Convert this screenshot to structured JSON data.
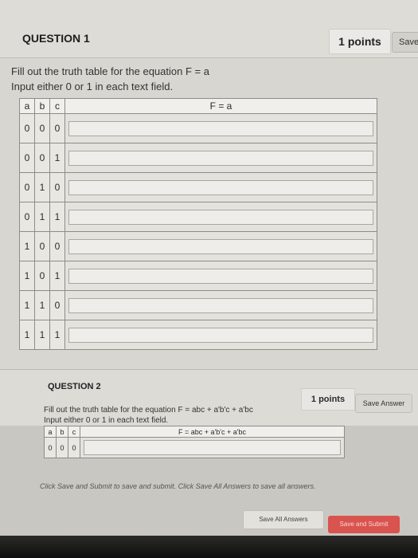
{
  "question1": {
    "title": "QUESTION 1",
    "points": "1 points",
    "save_label": "Save",
    "prompt": "Fill out the truth table for the equation F = a",
    "instructions": "Input either 0 or 1 in each text field.",
    "table": {
      "headers": [
        "a",
        "b",
        "c",
        "F = a"
      ],
      "rows": [
        [
          "0",
          "0",
          "0"
        ],
        [
          "0",
          "0",
          "1"
        ],
        [
          "0",
          "1",
          "0"
        ],
        [
          "0",
          "1",
          "1"
        ],
        [
          "1",
          "0",
          "0"
        ],
        [
          "1",
          "0",
          "1"
        ],
        [
          "1",
          "1",
          "0"
        ],
        [
          "1",
          "1",
          "1"
        ]
      ]
    }
  },
  "question2": {
    "title": "QUESTION 2",
    "points": "1 points",
    "save_label": "Save Answer",
    "prompt": "Fill out the truth table for the equation F = abc + a'b'c + a'bc",
    "instructions": "Input either 0 or 1 in each text field.",
    "table": {
      "headers": [
        "a",
        "b",
        "c",
        "F = abc + a'b'c + a'bc"
      ],
      "rows": [
        [
          "0",
          "0",
          "0"
        ]
      ]
    }
  },
  "footer": {
    "note": "Click Save and Submit to save and submit. Click Save All Answers to save all answers.",
    "save_all_label": "Save All Answers",
    "save_submit_label": "Save and Submit"
  },
  "colors": {
    "submit_button": "#d9534f",
    "page_background": "#d8d6d1"
  }
}
